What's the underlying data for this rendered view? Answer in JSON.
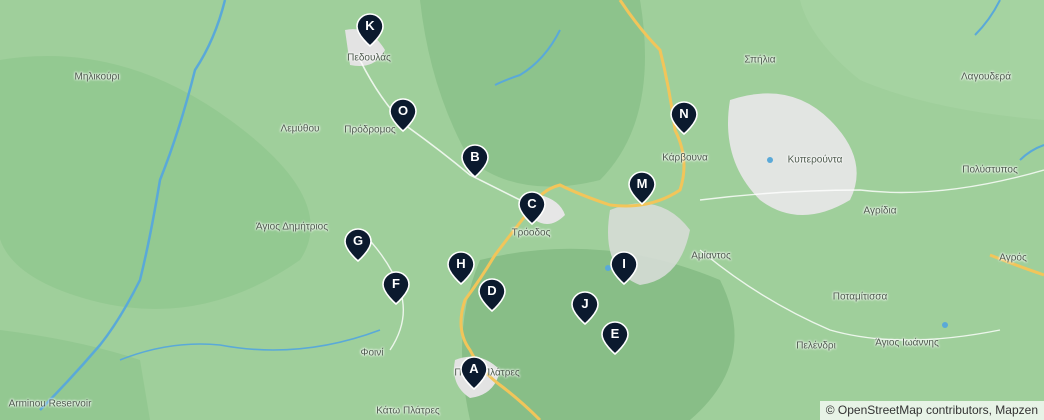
{
  "map": {
    "attribution": "© OpenStreetMap contributors, Mapzen",
    "colors": {
      "land": "#9fcf9b",
      "forest": "#86bd86",
      "water": "#5aa9d8",
      "road": "#f2c55a",
      "urban": "#e6e6e6"
    },
    "places": [
      {
        "id": "pedoulas",
        "name": "Πεδουλάς"
      },
      {
        "id": "milikouri",
        "name": "Μηλικούρι"
      },
      {
        "id": "lemythou",
        "name": "Λεμύθου"
      },
      {
        "id": "prodromos",
        "name": "Πρόδρομος"
      },
      {
        "id": "agios-dimitrios",
        "name": "Άγιος Δημήτριος"
      },
      {
        "id": "troodos",
        "name": "Τρόοδος"
      },
      {
        "id": "amiantos",
        "name": "Αμίαντος"
      },
      {
        "id": "spilia",
        "name": "Σπήλια"
      },
      {
        "id": "karvouna",
        "name": "Κάρβουνα"
      },
      {
        "id": "kyperounta",
        "name": "Κυπερούντα"
      },
      {
        "id": "lagoudera",
        "name": "Λαγουδερά"
      },
      {
        "id": "polystypos",
        "name": "Πολύστυπος"
      },
      {
        "id": "agridia",
        "name": "Αγρίδια"
      },
      {
        "id": "agros",
        "name": "Αγρός"
      },
      {
        "id": "potamitissa",
        "name": "Ποταμίτισσα"
      },
      {
        "id": "pelendri",
        "name": "Πελένδρι"
      },
      {
        "id": "agios-ioannis",
        "name": "Άγιος Ιωάννης"
      },
      {
        "id": "foini",
        "name": "Φοινί"
      },
      {
        "id": "pano-platres",
        "name": "Πάνω Πλάτρες"
      },
      {
        "id": "kato-platres",
        "name": "Κάτω Πλάτρες"
      },
      {
        "id": "arminou",
        "name": "Arminou Reservoir"
      }
    ],
    "markers": [
      {
        "label": "K"
      },
      {
        "label": "O"
      },
      {
        "label": "B"
      },
      {
        "label": "C"
      },
      {
        "label": "M"
      },
      {
        "label": "N"
      },
      {
        "label": "G"
      },
      {
        "label": "H"
      },
      {
        "label": "F"
      },
      {
        "label": "D"
      },
      {
        "label": "I"
      },
      {
        "label": "J"
      },
      {
        "label": "E"
      },
      {
        "label": "A"
      }
    ]
  }
}
